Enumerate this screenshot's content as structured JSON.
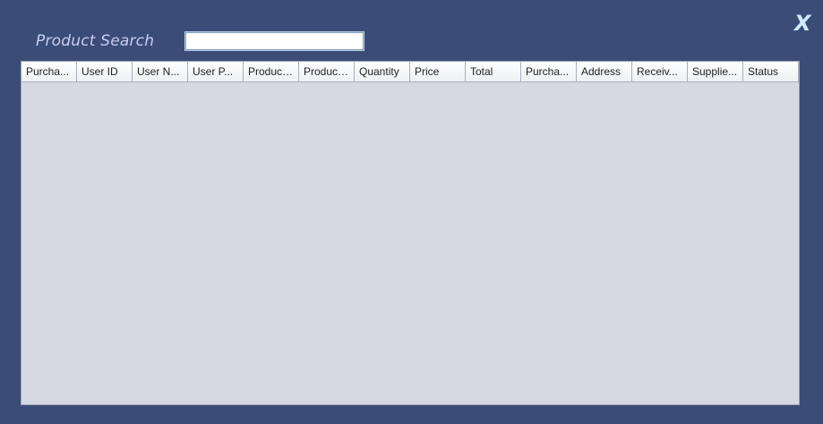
{
  "search": {
    "label": "Product Search",
    "value": ""
  },
  "window": {
    "close_label": "X"
  },
  "table": {
    "columns": [
      "Purcha...",
      "User ID",
      "User N...",
      "User P...",
      "Product...",
      "Product...",
      "Quantity",
      "Price",
      "Total",
      "Purcha...",
      "Address",
      "Receiv...",
      "Supplie...",
      "Status"
    ],
    "rows": []
  }
}
